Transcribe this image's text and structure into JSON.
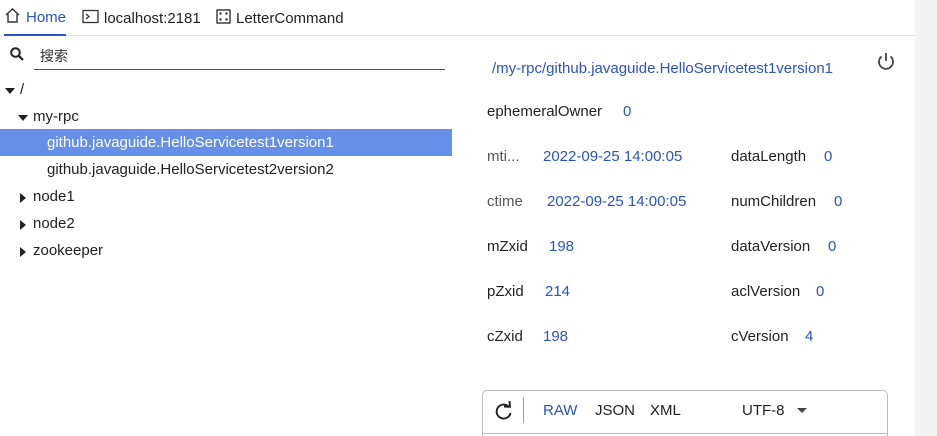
{
  "tabs": [
    {
      "label": "Home",
      "icon": "home-icon"
    },
    {
      "label": "localhost:2181",
      "icon": "terminal-icon"
    },
    {
      "label": "LetterCommand",
      "icon": "dice-icon"
    }
  ],
  "search": {
    "placeholder": "搜索",
    "value": ""
  },
  "tree": {
    "root": "/",
    "my_rpc": "my-rpc",
    "child1": "github.javaguide.HelloServicetest1version1",
    "child2": "github.javaguide.HelloServicetest2version2",
    "node1": "node1",
    "node2": "node2",
    "zookeeper": "zookeeper"
  },
  "detail": {
    "path": "/my-rpc/github.javaguide.HelloServicetest1version1",
    "ephemeralOwner": {
      "label": "ephemeralOwner",
      "value": "0"
    },
    "mtime": {
      "label": "mti...",
      "value": "2022-09-25 14:00:05"
    },
    "ctime": {
      "label": "ctime",
      "value": "2022-09-25 14:00:05"
    },
    "mZxid": {
      "label": "mZxid",
      "value": "198"
    },
    "pZxid": {
      "label": "pZxid",
      "value": "214"
    },
    "cZxid": {
      "label": "cZxid",
      "value": "198"
    },
    "dataLength": {
      "label": "dataLength",
      "value": "0"
    },
    "numChildren": {
      "label": "numChildren",
      "value": "0"
    },
    "dataVersion": {
      "label": "dataVersion",
      "value": "0"
    },
    "aclVersion": {
      "label": "aclVersion",
      "value": "0"
    },
    "cVersion": {
      "label": "cVersion",
      "value": "4"
    }
  },
  "data_panel": {
    "formats": [
      "RAW",
      "JSON",
      "XML"
    ],
    "selected_format": "RAW",
    "encoding": "UTF-8"
  },
  "colors": {
    "accent": "#2b53c4",
    "selection": "#6690e8"
  }
}
